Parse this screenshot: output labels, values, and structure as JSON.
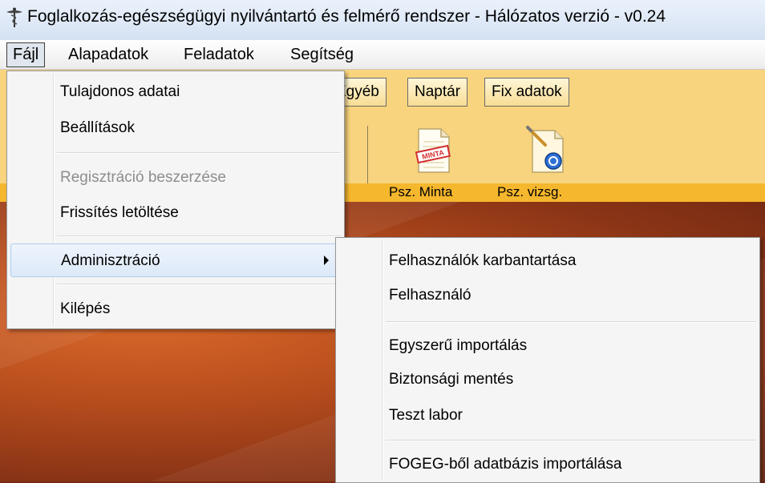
{
  "window": {
    "title": "Foglalkozás-egészségügyi nyilvántartó és felmérő rendszer - Hálózatos verzió  - v0.24"
  },
  "menubar": {
    "items": [
      "Fájl",
      "Alapadatok",
      "Feladatok",
      "Segítség"
    ]
  },
  "toolbar": {
    "buttons": [
      "Egyéb",
      "Naptár",
      "Fix adatok"
    ],
    "tools": [
      {
        "label": "Psz. Minta",
        "icon": "document-minta-icon",
        "badge": "MINTA"
      },
      {
        "label": "Psz. vizsg.",
        "icon": "document-exam-icon"
      }
    ]
  },
  "file_menu": {
    "items": [
      {
        "label": "Tulajdonos adatai",
        "disabled": false
      },
      {
        "label": "Beállítások",
        "disabled": false
      },
      {
        "label": "Regisztráció beszerzése",
        "disabled": true
      },
      {
        "label": "Frissítés letöltése",
        "disabled": false
      },
      {
        "label": "Adminisztráció",
        "disabled": false,
        "submenu": true,
        "highlighted": true
      },
      {
        "label": "Kilépés",
        "disabled": false
      }
    ]
  },
  "admin_submenu": {
    "items": [
      {
        "label": "Felhasználók karbantartása"
      },
      {
        "label": "Felhasználó"
      },
      {
        "label": "Egyszerű importálás"
      },
      {
        "label": "Biztonsági mentés"
      },
      {
        "label": "Teszt labor"
      },
      {
        "label": "FOGEG-ből adatbázis importálása"
      }
    ]
  },
  "colors": {
    "toolbar_bg": "#f9d47e",
    "icon_strip": "#f5b72d",
    "desktop": "#b74d1d",
    "highlight": "#dce9f8"
  }
}
